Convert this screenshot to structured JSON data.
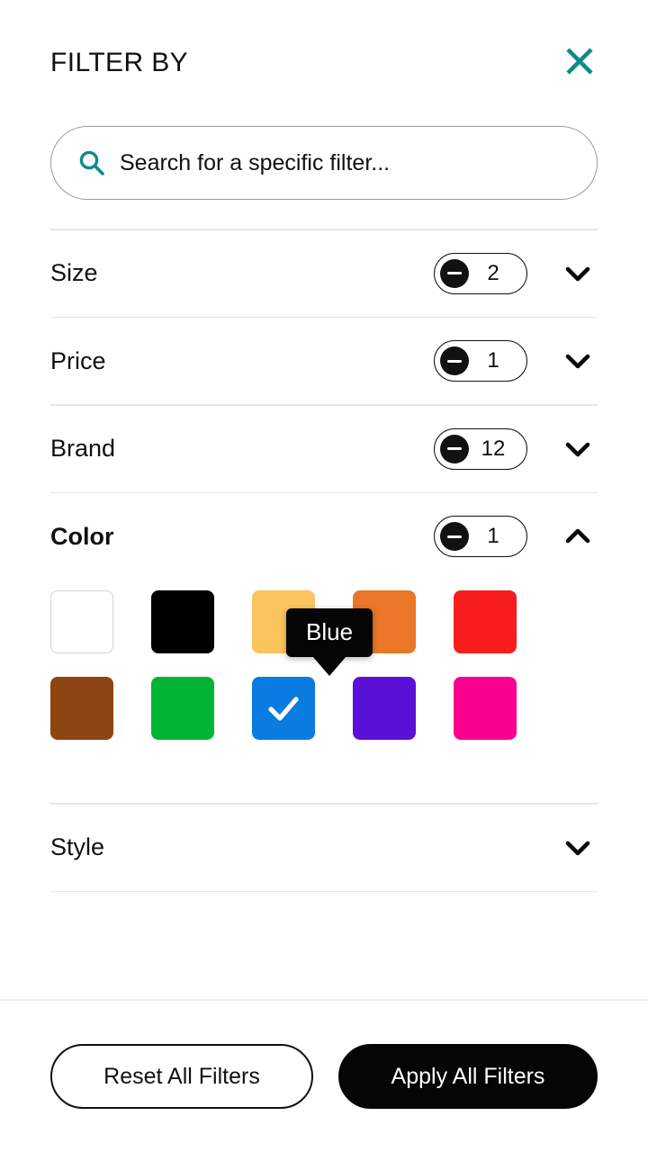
{
  "header": {
    "title": "FILTER BY",
    "close_icon": "close-icon",
    "close_color": "#0E8A8A"
  },
  "search": {
    "icon": "search-icon",
    "icon_color": "#0E8A8A",
    "placeholder": "Search for a specific filter...",
    "value": ""
  },
  "filters": [
    {
      "label": "Size",
      "count": "2",
      "has_count": true,
      "expanded": false,
      "chevron": "chevron-down-icon"
    },
    {
      "label": "Price",
      "count": "1",
      "has_count": true,
      "expanded": false,
      "chevron": "chevron-down-icon"
    },
    {
      "label": "Brand",
      "count": "12",
      "has_count": true,
      "expanded": false,
      "chevron": "chevron-down-icon"
    },
    {
      "label": "Color",
      "count": "1",
      "has_count": true,
      "expanded": true,
      "chevron": "chevron-up-icon"
    },
    {
      "label": "Style",
      "count": "",
      "has_count": false,
      "expanded": false,
      "chevron": "chevron-down-icon"
    }
  ],
  "color_options": {
    "rows": [
      [
        {
          "name": "White",
          "hex": "#FFFFFF",
          "selected": false,
          "bordered": true
        },
        {
          "name": "Black",
          "hex": "#000000",
          "selected": false,
          "bordered": false
        },
        {
          "name": "Yellow",
          "hex": "#FBC45E",
          "selected": false,
          "bordered": false
        },
        {
          "name": "Orange",
          "hex": "#E97727",
          "selected": false,
          "bordered": false
        },
        {
          "name": "Red",
          "hex": "#F91D1D",
          "selected": false,
          "bordered": false
        }
      ],
      [
        {
          "name": "Brown",
          "hex": "#8E4511",
          "selected": false,
          "bordered": false
        },
        {
          "name": "Green",
          "hex": "#00B436",
          "selected": false,
          "bordered": false
        },
        {
          "name": "Blue",
          "hex": "#0A7BE0",
          "selected": true,
          "bordered": false
        },
        {
          "name": "Purple",
          "hex": "#5B10D7",
          "selected": false,
          "bordered": false
        },
        {
          "name": "Pink",
          "hex": "#FA0090",
          "selected": false,
          "bordered": false
        }
      ]
    ],
    "tooltip": {
      "label": "Blue",
      "background": "#050505",
      "text_color": "#FFFFFF"
    },
    "check_icon": "check-icon"
  },
  "footer": {
    "reset_label": "Reset All Filters",
    "apply_label": "Apply All Filters"
  }
}
